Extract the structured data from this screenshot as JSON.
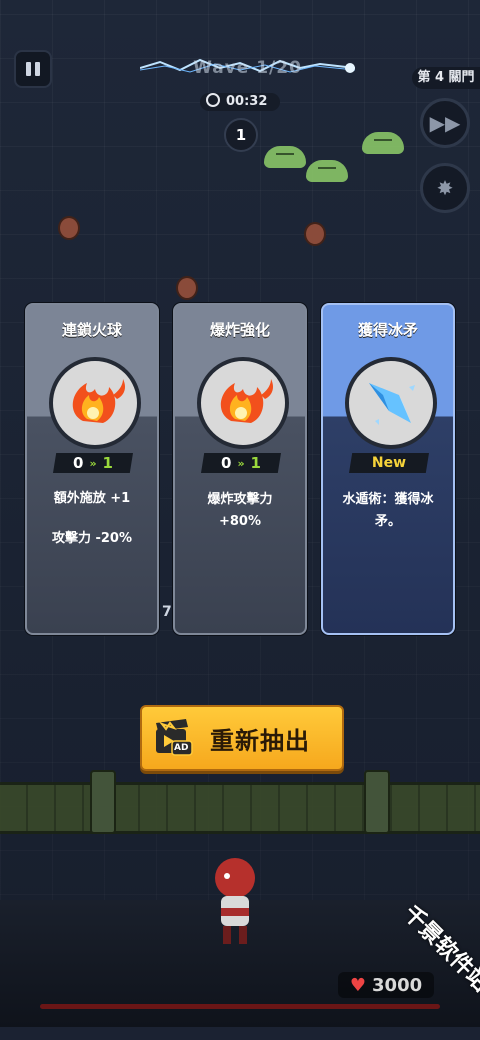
{
  "hud": {
    "wave_text": "Wave 1/20",
    "stage_label": "第 4 關門",
    "timer": "00:32",
    "enemy_count": "1",
    "floating_number": "7",
    "coins": "3000"
  },
  "cards": [
    {
      "title": "連鎖火球",
      "icon": "fireball-icon",
      "level_from": "0",
      "level_to": "1",
      "desc_lines": [
        "額外施放 +1",
        "攻擊力 -20%"
      ]
    },
    {
      "title": "爆炸強化",
      "icon": "fireball-icon",
      "level_from": "0",
      "level_to": "1",
      "desc_lines": [
        "爆炸攻擊力",
        "+80%"
      ]
    },
    {
      "title": "獲得冰矛",
      "icon": "ice-spear-icon",
      "badge": "New",
      "desc_lines": [
        "水遁術：獲得冰",
        "矛。"
      ]
    }
  ],
  "reroll": {
    "label": "重新抽出",
    "ad_badge": "AD"
  },
  "watermark": "千景软件站",
  "colors": {
    "card_gray": "#7c8596",
    "card_blue": "#6f9ae6",
    "button_gold": "#f6a81d",
    "level_green": "#9ad83c",
    "new_yellow": "#f6d33a"
  }
}
